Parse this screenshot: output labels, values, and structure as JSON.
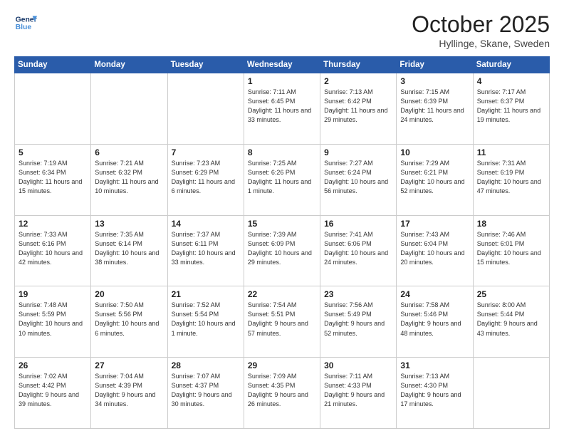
{
  "header": {
    "logo_line1": "General",
    "logo_line2": "Blue",
    "month_title": "October 2025",
    "subtitle": "Hyllinge, Skane, Sweden"
  },
  "days_of_week": [
    "Sunday",
    "Monday",
    "Tuesday",
    "Wednesday",
    "Thursday",
    "Friday",
    "Saturday"
  ],
  "weeks": [
    [
      {
        "day": "",
        "empty": true
      },
      {
        "day": "",
        "empty": true
      },
      {
        "day": "",
        "empty": true
      },
      {
        "day": "1",
        "sunrise": "7:11 AM",
        "sunset": "6:45 PM",
        "daylight": "11 hours and 33 minutes."
      },
      {
        "day": "2",
        "sunrise": "7:13 AM",
        "sunset": "6:42 PM",
        "daylight": "11 hours and 29 minutes."
      },
      {
        "day": "3",
        "sunrise": "7:15 AM",
        "sunset": "6:39 PM",
        "daylight": "11 hours and 24 minutes."
      },
      {
        "day": "4",
        "sunrise": "7:17 AM",
        "sunset": "6:37 PM",
        "daylight": "11 hours and 19 minutes."
      }
    ],
    [
      {
        "day": "5",
        "sunrise": "7:19 AM",
        "sunset": "6:34 PM",
        "daylight": "11 hours and 15 minutes."
      },
      {
        "day": "6",
        "sunrise": "7:21 AM",
        "sunset": "6:32 PM",
        "daylight": "11 hours and 10 minutes."
      },
      {
        "day": "7",
        "sunrise": "7:23 AM",
        "sunset": "6:29 PM",
        "daylight": "11 hours and 6 minutes."
      },
      {
        "day": "8",
        "sunrise": "7:25 AM",
        "sunset": "6:26 PM",
        "daylight": "11 hours and 1 minute."
      },
      {
        "day": "9",
        "sunrise": "7:27 AM",
        "sunset": "6:24 PM",
        "daylight": "10 hours and 56 minutes."
      },
      {
        "day": "10",
        "sunrise": "7:29 AM",
        "sunset": "6:21 PM",
        "daylight": "10 hours and 52 minutes."
      },
      {
        "day": "11",
        "sunrise": "7:31 AM",
        "sunset": "6:19 PM",
        "daylight": "10 hours and 47 minutes."
      }
    ],
    [
      {
        "day": "12",
        "sunrise": "7:33 AM",
        "sunset": "6:16 PM",
        "daylight": "10 hours and 42 minutes."
      },
      {
        "day": "13",
        "sunrise": "7:35 AM",
        "sunset": "6:14 PM",
        "daylight": "10 hours and 38 minutes."
      },
      {
        "day": "14",
        "sunrise": "7:37 AM",
        "sunset": "6:11 PM",
        "daylight": "10 hours and 33 minutes."
      },
      {
        "day": "15",
        "sunrise": "7:39 AM",
        "sunset": "6:09 PM",
        "daylight": "10 hours and 29 minutes."
      },
      {
        "day": "16",
        "sunrise": "7:41 AM",
        "sunset": "6:06 PM",
        "daylight": "10 hours and 24 minutes."
      },
      {
        "day": "17",
        "sunrise": "7:43 AM",
        "sunset": "6:04 PM",
        "daylight": "10 hours and 20 minutes."
      },
      {
        "day": "18",
        "sunrise": "7:46 AM",
        "sunset": "6:01 PM",
        "daylight": "10 hours and 15 minutes."
      }
    ],
    [
      {
        "day": "19",
        "sunrise": "7:48 AM",
        "sunset": "5:59 PM",
        "daylight": "10 hours and 10 minutes."
      },
      {
        "day": "20",
        "sunrise": "7:50 AM",
        "sunset": "5:56 PM",
        "daylight": "10 hours and 6 minutes."
      },
      {
        "day": "21",
        "sunrise": "7:52 AM",
        "sunset": "5:54 PM",
        "daylight": "10 hours and 1 minute."
      },
      {
        "day": "22",
        "sunrise": "7:54 AM",
        "sunset": "5:51 PM",
        "daylight": "9 hours and 57 minutes."
      },
      {
        "day": "23",
        "sunrise": "7:56 AM",
        "sunset": "5:49 PM",
        "daylight": "9 hours and 52 minutes."
      },
      {
        "day": "24",
        "sunrise": "7:58 AM",
        "sunset": "5:46 PM",
        "daylight": "9 hours and 48 minutes."
      },
      {
        "day": "25",
        "sunrise": "8:00 AM",
        "sunset": "5:44 PM",
        "daylight": "9 hours and 43 minutes."
      }
    ],
    [
      {
        "day": "26",
        "sunrise": "7:02 AM",
        "sunset": "4:42 PM",
        "daylight": "9 hours and 39 minutes."
      },
      {
        "day": "27",
        "sunrise": "7:04 AM",
        "sunset": "4:39 PM",
        "daylight": "9 hours and 34 minutes."
      },
      {
        "day": "28",
        "sunrise": "7:07 AM",
        "sunset": "4:37 PM",
        "daylight": "9 hours and 30 minutes."
      },
      {
        "day": "29",
        "sunrise": "7:09 AM",
        "sunset": "4:35 PM",
        "daylight": "9 hours and 26 minutes."
      },
      {
        "day": "30",
        "sunrise": "7:11 AM",
        "sunset": "4:33 PM",
        "daylight": "9 hours and 21 minutes."
      },
      {
        "day": "31",
        "sunrise": "7:13 AM",
        "sunset": "4:30 PM",
        "daylight": "9 hours and 17 minutes."
      },
      {
        "day": "",
        "empty": true
      }
    ]
  ]
}
